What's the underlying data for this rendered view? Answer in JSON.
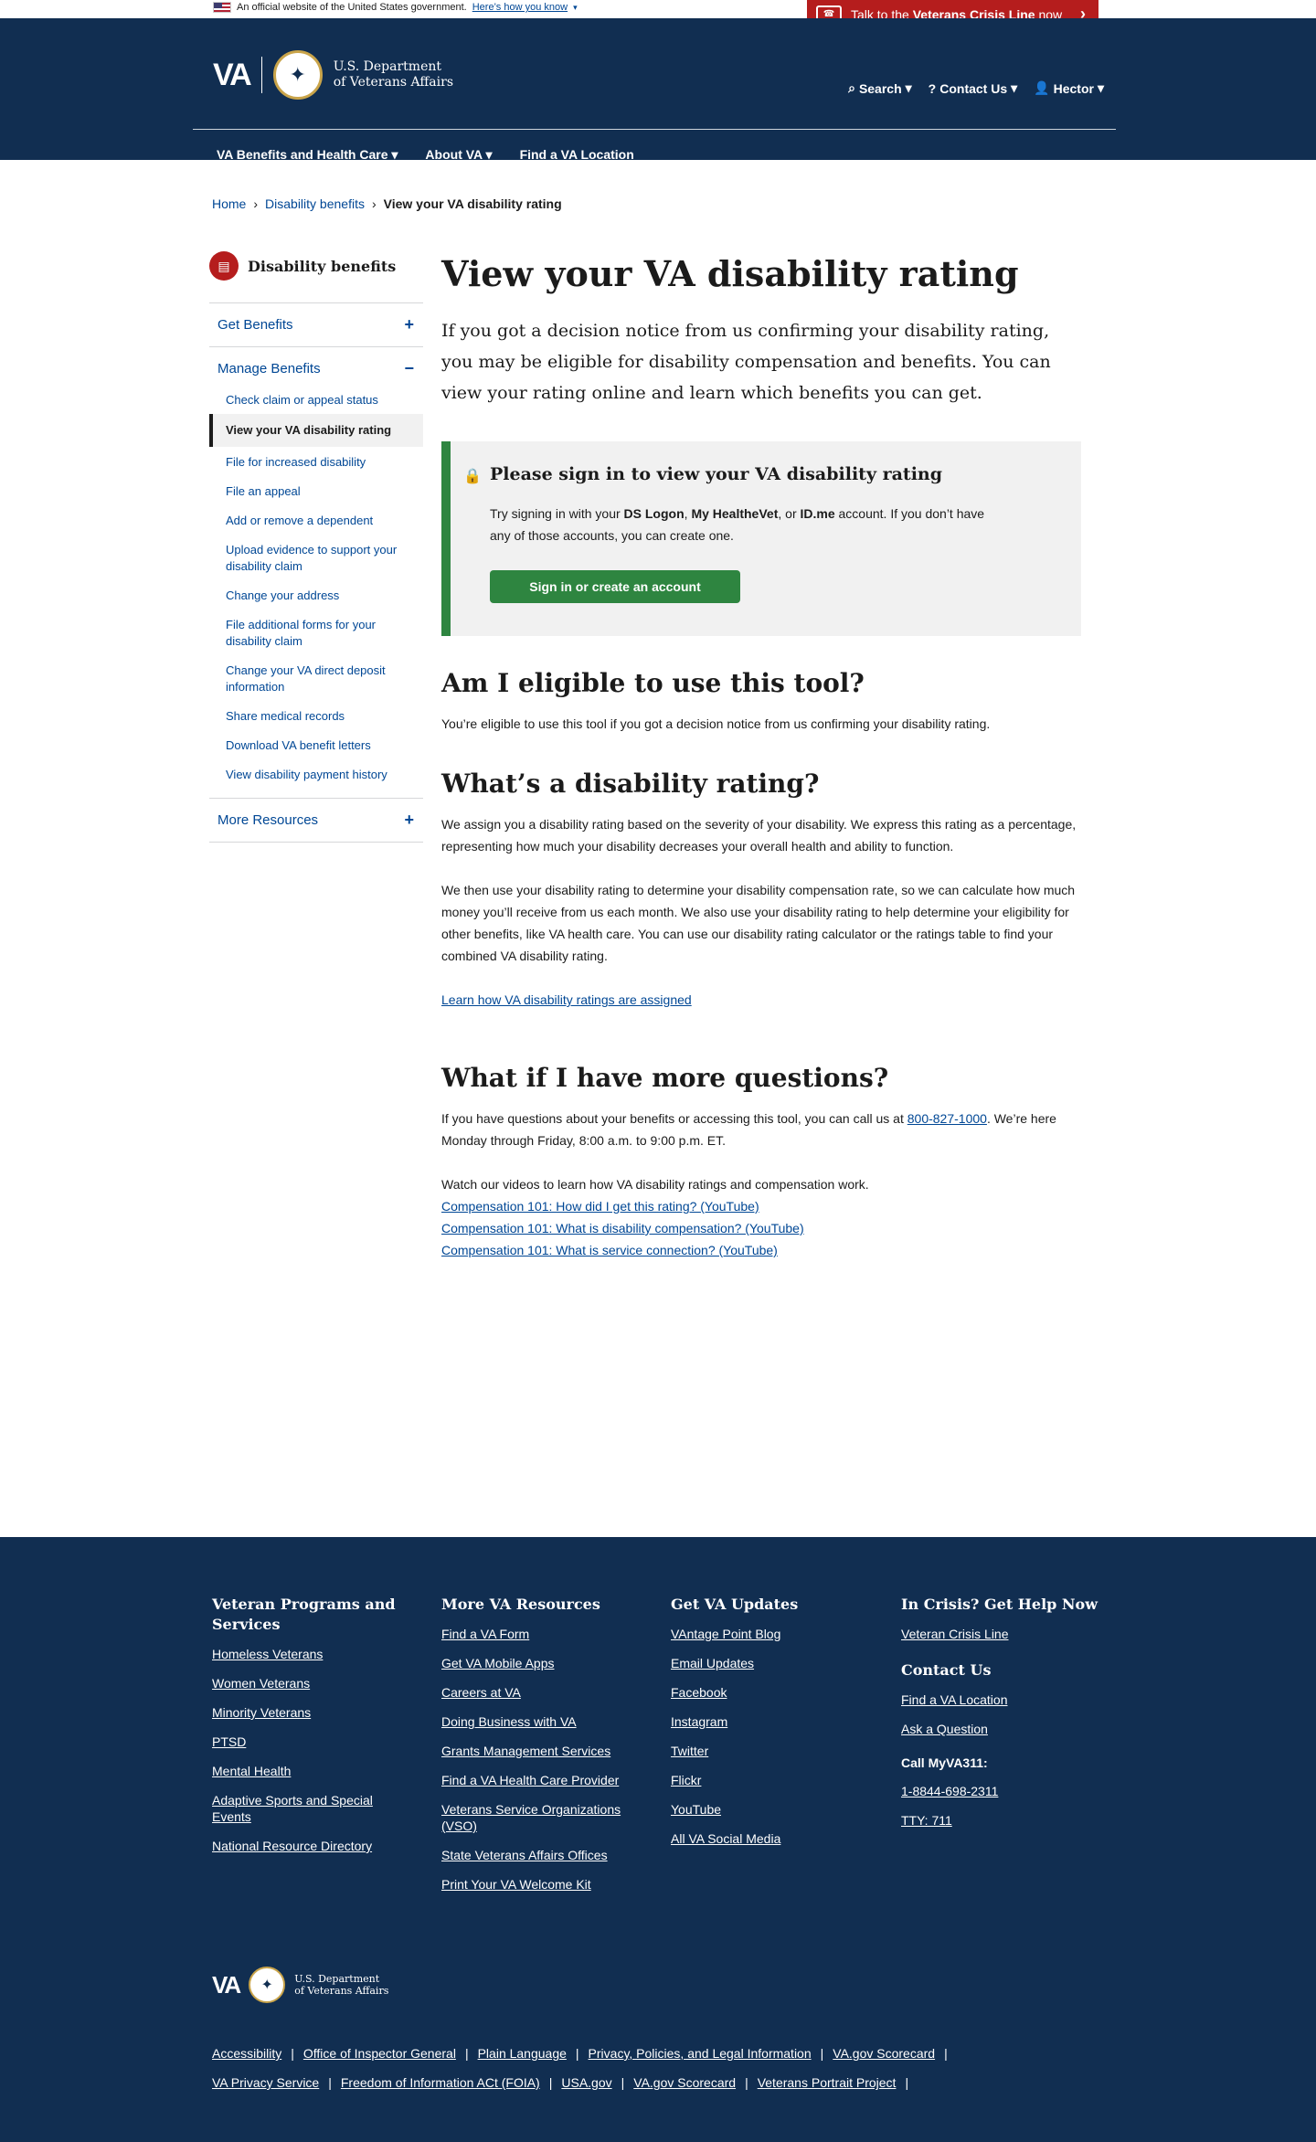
{
  "gov_banner": {
    "text": "An official website of the United States government.",
    "link": "Here’s how you know"
  },
  "crisis": {
    "prefix": "Talk to the",
    "strong": "Veterans Crisis Line",
    "suffix": "now"
  },
  "header": {
    "logo_text": "VA",
    "dept_line1": "U.S. Department",
    "dept_line2": "of Veterans Affairs",
    "util": {
      "search": "Search",
      "contact": "Contact Us",
      "user": "Hector"
    },
    "nav": [
      "VA Benefits and Health Care",
      "About VA",
      "Find a VA Location"
    ]
  },
  "breadcrumb": {
    "home": "Home",
    "parent": "Disability benefits",
    "current": "View your VA disability rating"
  },
  "sidebar": {
    "title": "Disability benefits",
    "get_benefits": "Get Benefits",
    "manage_benefits": "Manage Benefits",
    "items": [
      "Check claim or appeal status",
      "View your VA disability rating",
      "File for increased disability",
      "File an appeal",
      "Add or remove a dependent",
      "Upload evidence to support your disability claim",
      "Change your address",
      "File additional forms for your disability claim",
      "Change your VA direct deposit information",
      "Share medical records",
      "Download VA benefit letters",
      "View disability payment history"
    ],
    "more_resources": "More Resources",
    "plus": "+",
    "minus": "−"
  },
  "main": {
    "title": "View your VA disability rating",
    "lead": "If you got a decision notice from us confirming your disability rating, you may be eligible for disability compensation and benefits. You can view your rating online and learn which benefits you can get.",
    "alert_title": "Please sign in to view your VA disability rating",
    "alert_p1": "Try signing in with your",
    "alert_b1": "DS Logon",
    "alert_b2": "My HealtheVet",
    "alert_b3": "ID.me",
    "alert_p2": "account. If you don’t have any of those accounts, you can create one.",
    "alert_button": "Sign in or create an account",
    "h_eligible": "Am I eligible to use this tool?",
    "p_eligible": "You’re eligible to use this tool if you got a decision notice from us confirming your disability rating.",
    "h_rating": "What’s a disability rating?",
    "p_rating1": "We assign you a disability rating based on the severity of your disability. We express this rating as a percentage, representing how much your disability decreases your overall health and ability to function.",
    "p_rating2": "We then use your disability rating to determine your disability compensation rate, so we can calculate how much money you’ll receive from us each month. We also use your disability rating to help determine your eligibility for other benefits, like VA health care. You can use our disability rating calculator or the ratings table to find your combined VA disability rating.",
    "link_learn": "Learn how VA disability ratings are assigned",
    "h_questions": "What if I have more questions?",
    "p_q1a": "If you have questions about your benefits or accessing this tool, you can call us at",
    "phone": "800-827-1000",
    "p_q1b": ". We’re here Monday through Friday, 8:00 a.m. to 9:00 p.m. ET.",
    "p_videos": "Watch our videos to learn how VA disability ratings and compensation work.",
    "videos": [
      "Compensation 101: How did I get this rating? (YouTube)",
      "Compensation 101: What is disability compensation? (YouTube)",
      "Compensation 101: What is service connection? (YouTube)"
    ]
  },
  "footer": {
    "col1": {
      "title": "Veteran Programs and Services",
      "links": [
        "Homeless Veterans",
        "Women Veterans",
        "Minority Veterans",
        "PTSD",
        "Mental Health",
        "Adaptive Sports and Special Events",
        "National Resource Directory"
      ]
    },
    "col2": {
      "title": "More VA Resources",
      "links": [
        "Find a VA Form",
        "Get VA Mobile Apps",
        "Careers at VA",
        "Doing Business with VA",
        "Grants Management Services",
        "Find a VA Health Care Provider",
        "Veterans Service Organizations (VSO)",
        "State Veterans Affairs Offices",
        "Print Your VA Welcome Kit"
      ]
    },
    "col3": {
      "title": "Get VA Updates",
      "links": [
        "VAntage Point Blog",
        "Email Updates",
        "Facebook",
        "Instagram",
        "Twitter",
        "Flickr",
        "YouTube",
        "All VA Social Media"
      ]
    },
    "col4": {
      "title": "In Crisis? Get Help Now",
      "crisis_link": "Veteran Crisis Line",
      "contact_title": "Contact Us",
      "contact_links": [
        "Find a VA Location",
        "Ask a Question"
      ],
      "call_label": "Call MyVA311:",
      "call_links": [
        "1-8844-698-2311",
        "TTY: 711"
      ]
    },
    "logo_text": "VA",
    "dept_line1": "U.S. Department",
    "dept_line2": "of Veterans Affairs",
    "row1": [
      "Accessibility",
      "Office of Inspector General",
      "Plain Language",
      "Privacy, Policies, and Legal Information",
      "VA.gov Scorecard"
    ],
    "row2": [
      "VA Privacy Service",
      "Freedom of Information ACt (FOIA)",
      "USA.gov",
      "VA.gov Scorecard",
      "Veterans Portrait Project"
    ]
  }
}
